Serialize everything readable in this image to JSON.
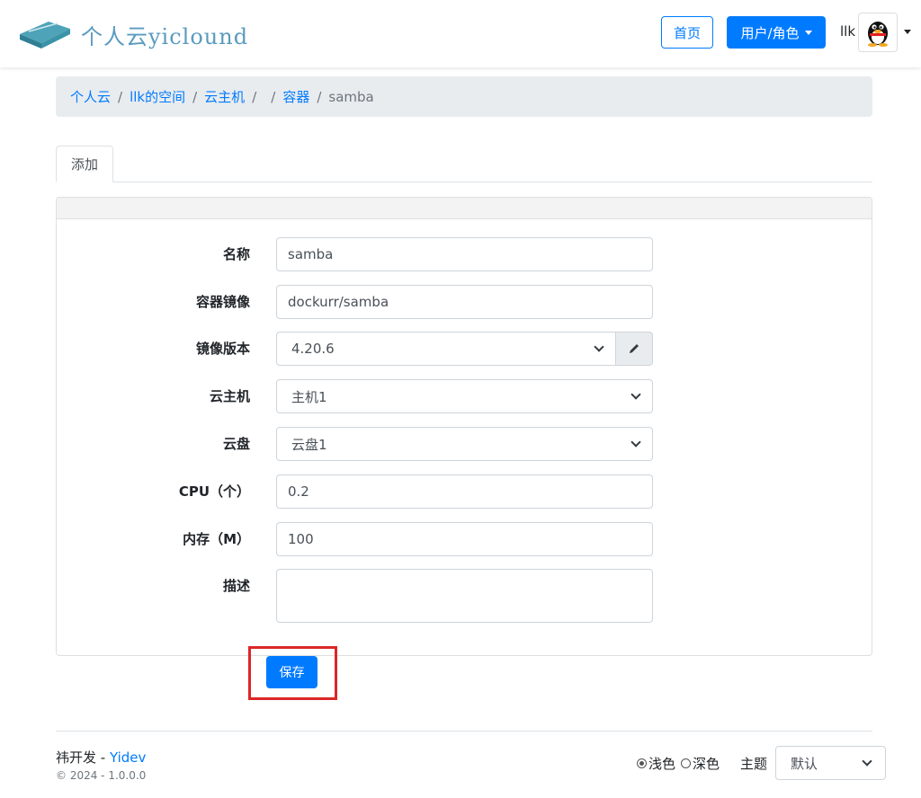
{
  "header": {
    "brand": "个人云yiclound",
    "home_label": "首页",
    "user_menu_label": "用户/角色",
    "username": "llk"
  },
  "breadcrumb": {
    "items": [
      "个人云",
      "llk的空间",
      "云主机",
      "",
      "容器"
    ],
    "active": "samba"
  },
  "tabs": [
    {
      "label": "添加"
    }
  ],
  "form": {
    "name": {
      "label": "名称",
      "value": "samba"
    },
    "image": {
      "label": "容器镜像",
      "value": "dockurr/samba"
    },
    "version": {
      "label": "镜像版本",
      "value": "4.20.6"
    },
    "host": {
      "label": "云主机",
      "value": "主机1"
    },
    "disk": {
      "label": "云盘",
      "value": "云盘1"
    },
    "cpu": {
      "label": "CPU（个）",
      "value": "0.2"
    },
    "memory": {
      "label": "内存（M）",
      "value": "100"
    },
    "description": {
      "label": "描述",
      "value": ""
    },
    "save_label": "保存"
  },
  "footer": {
    "dev_prefix": "祎开发 - ",
    "dev_link": "Yidev",
    "copyright": "© 2024 - 1.0.0.0",
    "light_label": "浅色",
    "dark_label": "深色",
    "theme_label": "主题",
    "theme_value": "默认"
  },
  "colors": {
    "primary": "#007bff",
    "highlight": "#dc2626"
  }
}
